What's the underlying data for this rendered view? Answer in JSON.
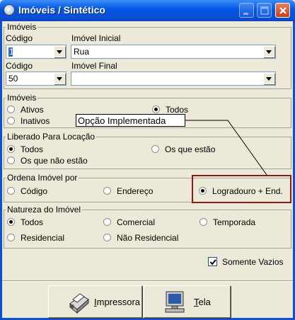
{
  "window": {
    "title": "Imóveis / Sintético",
    "icons": [
      "app-icon",
      "minimize-icon",
      "maximize-icon",
      "close-icon"
    ]
  },
  "group_imoveis_top": {
    "legend": "Imóveis",
    "codigo_label_1": "Código",
    "codigo_value_1": "1",
    "imovel_inicial_label": "Imóvel Inicial",
    "imovel_inicial_value": "Rua",
    "codigo_label_2": "Código",
    "codigo_value_2": "50",
    "imovel_final_label": "Imóvel Final",
    "imovel_final_value": ""
  },
  "group_imoveis_status": {
    "legend": "Imóveis",
    "options": [
      "Ativos",
      "Inativos",
      "Todos"
    ],
    "selected": "Todos"
  },
  "group_liberado": {
    "legend": "Liberado Para Locação",
    "options": [
      "Todos",
      "Os que não estão",
      "Os que estão"
    ],
    "selected": "Todos"
  },
  "group_ordena": {
    "legend": "Ordena Imóvel por",
    "options": [
      "Código",
      "Endereço",
      "Logradouro + End."
    ],
    "selected": "Logradouro + End."
  },
  "group_natureza": {
    "legend": "Natureza do Imóvel",
    "options": [
      "Todos",
      "Comercial",
      "Temporada",
      "Residencial",
      "Não Residencial"
    ],
    "selected": "Todos"
  },
  "annotation": {
    "callout_text": "Opção Implementada",
    "highlight_color": "#8b1a1a"
  },
  "somente_vazios": {
    "label": "Somente Vazios",
    "checked": true
  },
  "buttons": {
    "impressora_first": "I",
    "impressora_rest": "mpressora",
    "tela_first": "T",
    "tela_rest": "ela"
  },
  "colors": {
    "titlebar": "#0054e3",
    "dialog_bg": "#ece9d8"
  }
}
